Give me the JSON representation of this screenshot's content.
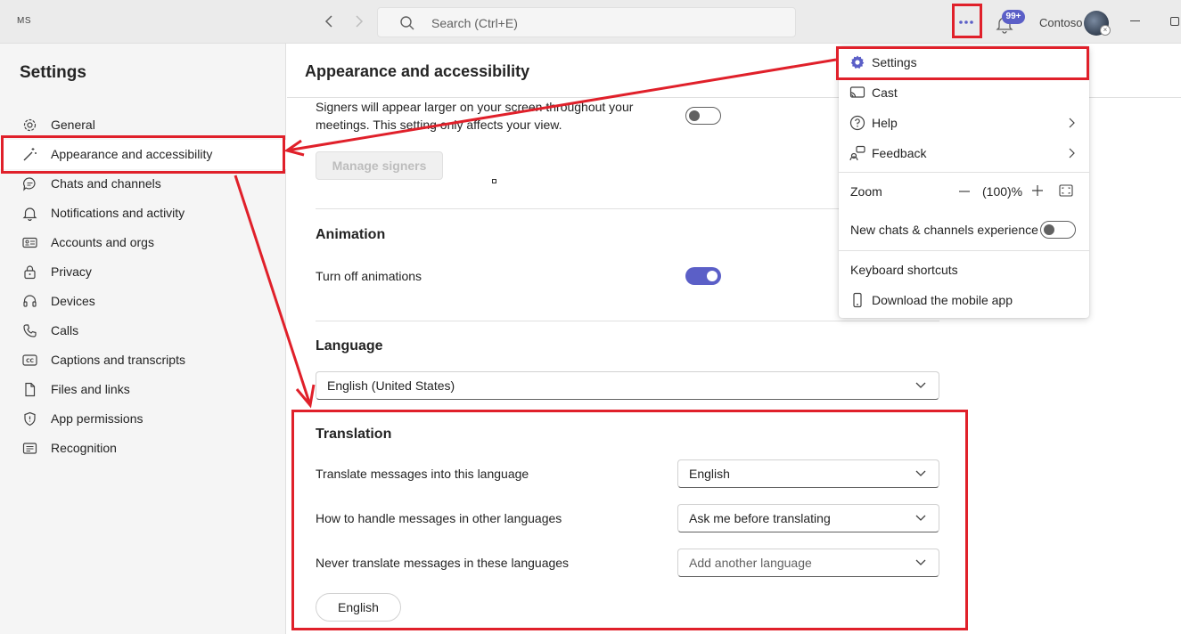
{
  "titlebar": {
    "app_logo": "MS",
    "search_placeholder": "Search (Ctrl+E)",
    "notification_badge": "99+",
    "org_name": "Contoso"
  },
  "sidebar": {
    "title": "Settings",
    "items": [
      {
        "label": "General",
        "icon": "gear-icon"
      },
      {
        "label": "Appearance and accessibility",
        "icon": "wand-icon",
        "active": true
      },
      {
        "label": "Chats and channels",
        "icon": "chat-icon"
      },
      {
        "label": "Notifications and activity",
        "icon": "bell-icon"
      },
      {
        "label": "Accounts and orgs",
        "icon": "id-card-icon"
      },
      {
        "label": "Privacy",
        "icon": "lock-icon"
      },
      {
        "label": "Devices",
        "icon": "headset-icon"
      },
      {
        "label": "Calls",
        "icon": "phone-icon"
      },
      {
        "label": "Captions and transcripts",
        "icon": "cc-icon"
      },
      {
        "label": "Files and links",
        "icon": "file-icon"
      },
      {
        "label": "App permissions",
        "icon": "shield-icon"
      },
      {
        "label": "Recognition",
        "icon": "recognition-icon"
      }
    ]
  },
  "main": {
    "title": "Appearance and accessibility",
    "signers": {
      "text": "Signers will appear larger on your screen throughout your meetings. This setting only affects your view.",
      "toggle_on": false,
      "button": "Manage signers"
    },
    "animation": {
      "heading": "Animation",
      "label": "Turn off animations",
      "toggle_on": true
    },
    "language": {
      "heading": "Language",
      "value": "English (United States)"
    },
    "translation": {
      "heading": "Translation",
      "rows": [
        {
          "label": "Translate messages into this language",
          "value": "English"
        },
        {
          "label": "How to handle messages in other languages",
          "value": "Ask me before translating"
        },
        {
          "label": "Never translate messages in these languages",
          "placeholder": "Add another language"
        }
      ],
      "chip": "English"
    }
  },
  "menu": {
    "items": [
      {
        "label": "Settings",
        "icon": "gear-icon"
      },
      {
        "label": "Cast",
        "icon": "cast-icon"
      },
      {
        "label": "Help",
        "icon": "help-icon",
        "submenu": true
      },
      {
        "label": "Feedback",
        "icon": "feedback-icon",
        "submenu": true
      }
    ],
    "zoom_label": "Zoom",
    "zoom_value": "(100)%",
    "new_experience_label": "New chats & channels experience",
    "new_experience_on": false,
    "keyboard_shortcuts": "Keyboard shortcuts",
    "download_mobile": "Download the mobile app"
  },
  "colors": {
    "accent": "#5b5fc7",
    "annotation": "#e0202a"
  }
}
